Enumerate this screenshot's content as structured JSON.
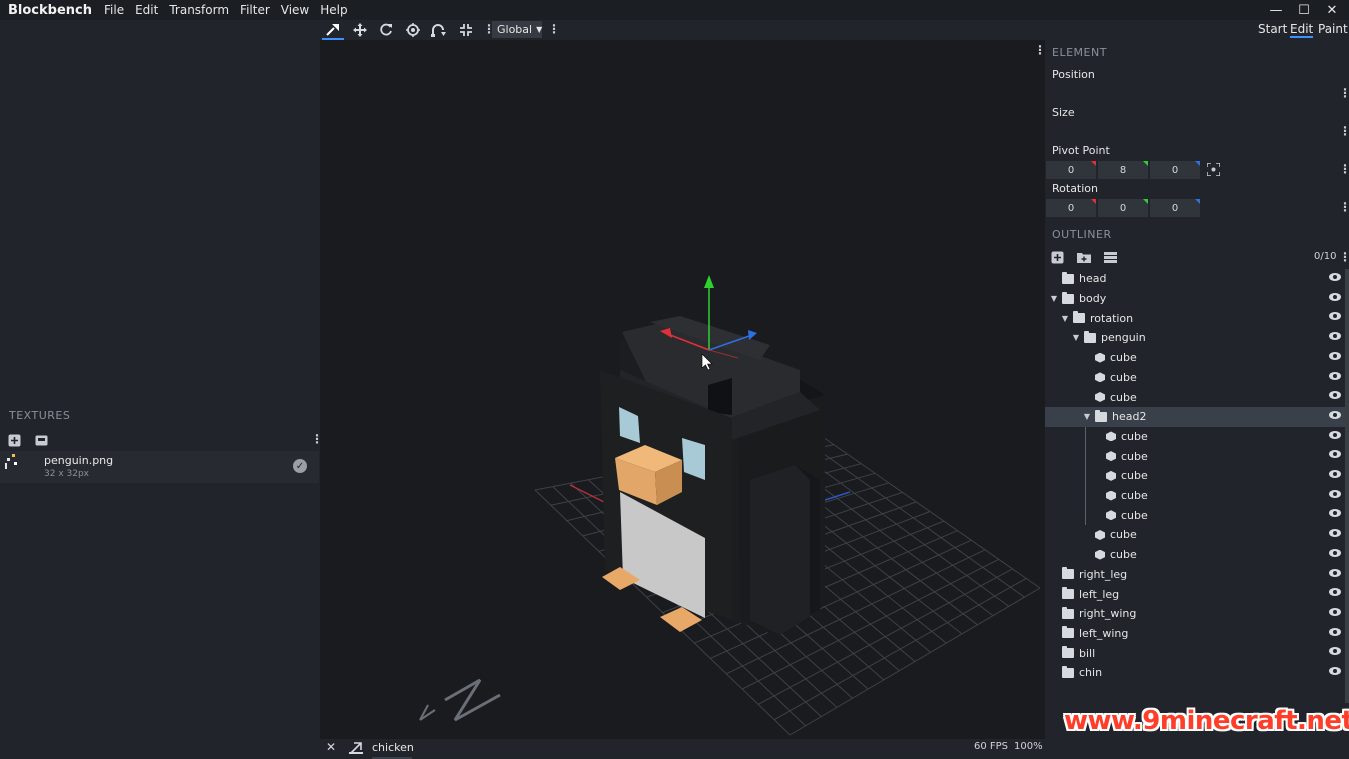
{
  "app": {
    "title": "Blockbench"
  },
  "menu": [
    "File",
    "Edit",
    "Transform",
    "Filter",
    "View",
    "Help"
  ],
  "window_controls": {
    "minimize": "—",
    "maximize": "☐",
    "close": "✕"
  },
  "modes": {
    "start": "Start",
    "edit": "Edit",
    "paint": "Paint",
    "active": "Edit"
  },
  "toolbar": {
    "transform_space": "Global",
    "icons": [
      "move-select-icon",
      "translate-icon",
      "rotate-icon",
      "pivot-icon",
      "vertex-snap-icon",
      "resize-icon"
    ]
  },
  "textures": {
    "title": "TEXTURES",
    "items": [
      {
        "name": "penguin.png",
        "size": "32 x 32px"
      }
    ]
  },
  "element": {
    "title": "ELEMENT",
    "position_label": "Position",
    "size_label": "Size",
    "pivot_label": "Pivot Point",
    "pivot": [
      "0",
      "8",
      "0"
    ],
    "rotation_label": "Rotation",
    "rotation": [
      "0",
      "0",
      "0"
    ]
  },
  "outliner": {
    "title": "OUTLINER",
    "count": "0/10",
    "nodes": [
      {
        "label": "head",
        "type": "folder",
        "depth": 0,
        "open": false
      },
      {
        "label": "body",
        "type": "folder",
        "depth": 0,
        "open": true
      },
      {
        "label": "rotation",
        "type": "folder",
        "depth": 1,
        "open": true
      },
      {
        "label": "penguin",
        "type": "folder",
        "depth": 2,
        "open": true
      },
      {
        "label": "cube",
        "type": "cube",
        "depth": 3
      },
      {
        "label": "cube",
        "type": "cube",
        "depth": 3
      },
      {
        "label": "cube",
        "type": "cube",
        "depth": 3
      },
      {
        "label": "head2",
        "type": "folder",
        "depth": 3,
        "open": true,
        "selected": true
      },
      {
        "label": "cube",
        "type": "cube",
        "depth": 4
      },
      {
        "label": "cube",
        "type": "cube",
        "depth": 4
      },
      {
        "label": "cube",
        "type": "cube",
        "depth": 4
      },
      {
        "label": "cube",
        "type": "cube",
        "depth": 4
      },
      {
        "label": "cube",
        "type": "cube",
        "depth": 4
      },
      {
        "label": "cube",
        "type": "cube",
        "depth": 3
      },
      {
        "label": "cube",
        "type": "cube",
        "depth": 3
      },
      {
        "label": "right_leg",
        "type": "folder",
        "depth": 0,
        "open": false
      },
      {
        "label": "left_leg",
        "type": "folder",
        "depth": 0,
        "open": false
      },
      {
        "label": "right_wing",
        "type": "folder",
        "depth": 0,
        "open": false
      },
      {
        "label": "left_wing",
        "type": "folder",
        "depth": 0,
        "open": false
      },
      {
        "label": "bill",
        "type": "folder",
        "depth": 0,
        "open": false
      },
      {
        "label": "chin",
        "type": "folder",
        "depth": 0,
        "open": false
      }
    ]
  },
  "status": {
    "tab_name": "chicken",
    "fps": "60 FPS",
    "zoom": "100%"
  },
  "watermark": "www.9minecraft.net",
  "colors": {
    "accent": "#3e90ff",
    "axis_x": "#e0313a",
    "axis_y": "#2fd12f",
    "axis_z": "#2f6fe0",
    "selection": "#3a4049"
  }
}
